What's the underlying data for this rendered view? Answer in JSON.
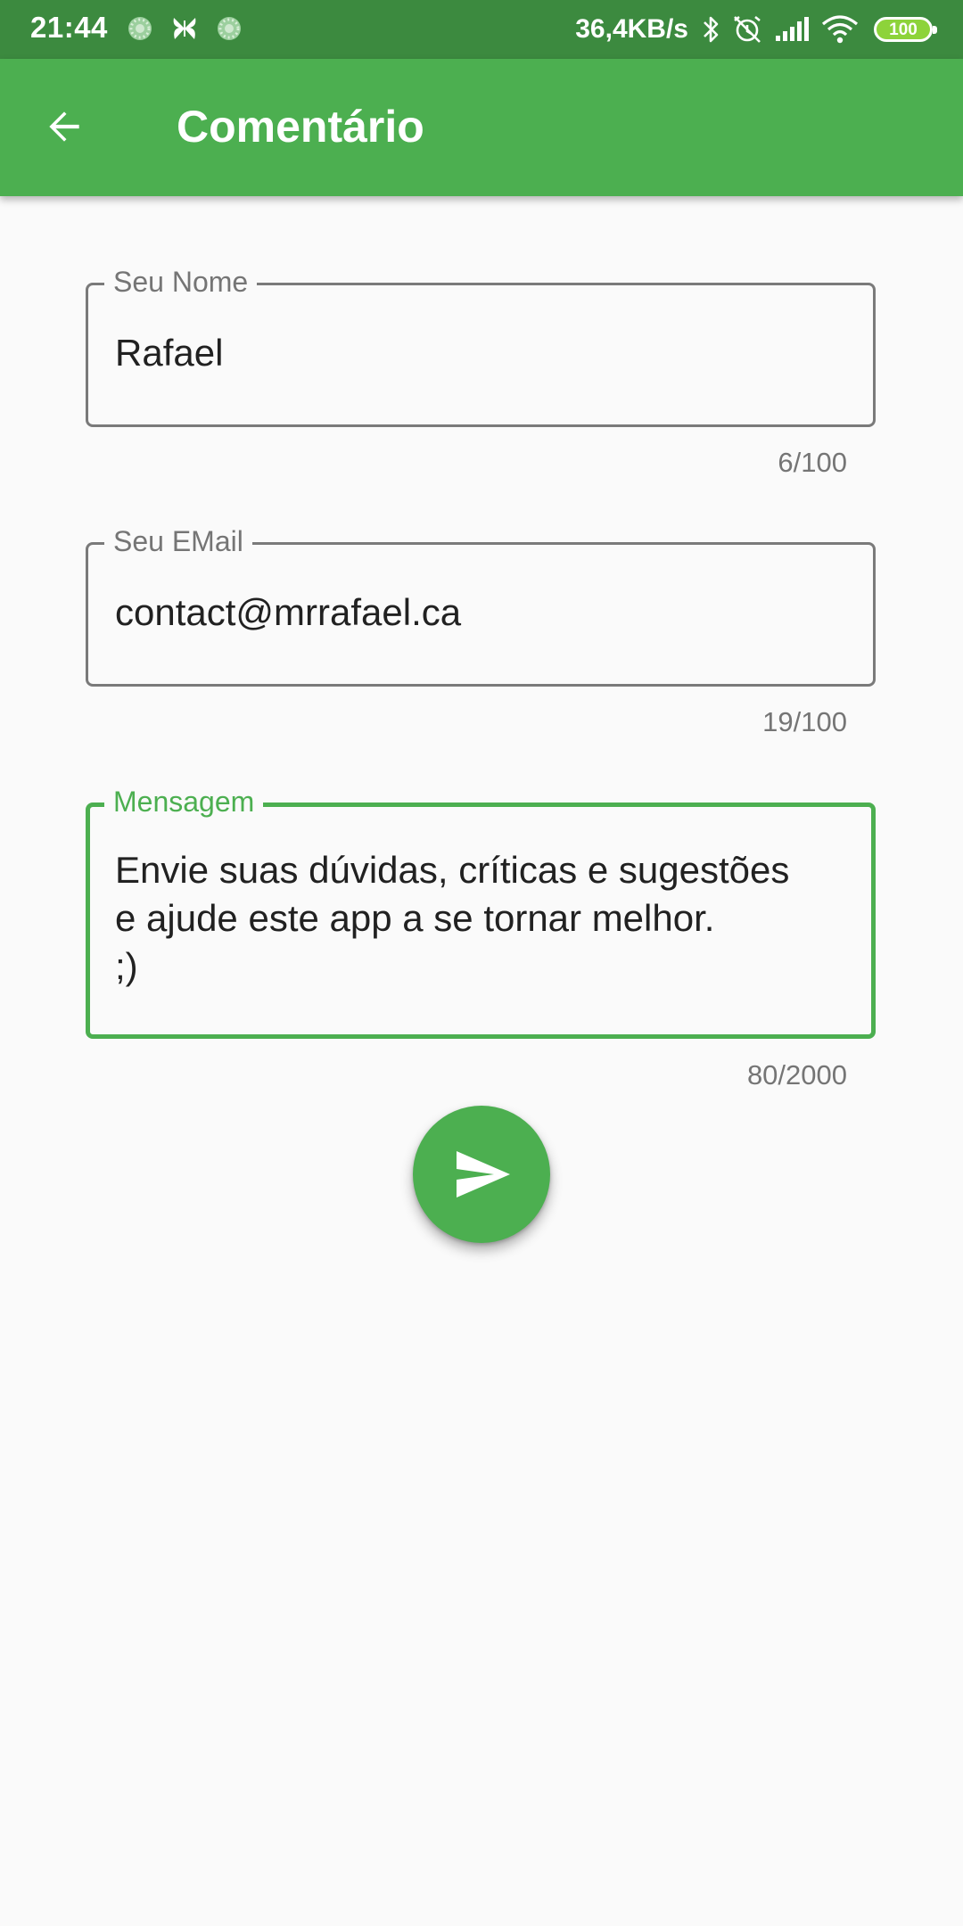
{
  "status_bar": {
    "time": "21:44",
    "net_speed": "36,4KB/s",
    "battery_level": "100",
    "notification_icons": [
      "blur-dot-icon",
      "butterfly-icon",
      "blur-dot-icon"
    ],
    "system_icons": [
      "bluetooth-icon",
      "alarm-off-icon",
      "signal-icon",
      "wifi-icon",
      "battery-icon"
    ]
  },
  "app_bar": {
    "title": "Comentário",
    "back_icon": "arrow-back-icon"
  },
  "form": {
    "name": {
      "label": "Seu Nome",
      "value": "Rafael",
      "counter": "6/100"
    },
    "email": {
      "label": "Seu EMail",
      "value": "contact@mrrafael.ca",
      "counter": "19/100"
    },
    "message": {
      "label": "Mensagem",
      "value": "Envie suas dúvidas, críticas e sugestões\ne ajude este app a se tornar melhor.\n;)",
      "counter": "80/2000",
      "focused": true
    }
  },
  "send_button": {
    "icon": "send-icon"
  },
  "colors": {
    "primary": "#4caf50",
    "status_bar": "#3c8a3f",
    "background": "#fafafa",
    "border": "#7a7a7a",
    "text": "#212121",
    "secondary_text": "#757575",
    "battery_fill": "#8dd33a"
  }
}
